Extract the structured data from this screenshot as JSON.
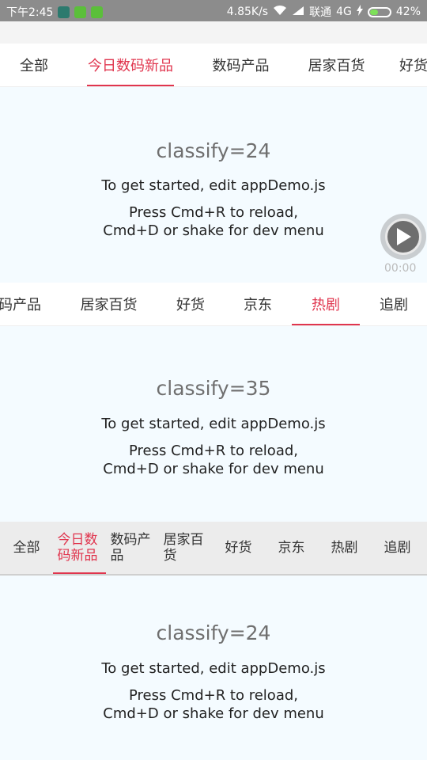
{
  "status_bar": {
    "time": "下午2:45",
    "speed": "4.85K/s",
    "carrier": "联通",
    "network": "4G",
    "battery": "42%",
    "battery_level": 0.42,
    "icons": [
      "notification-app-icon",
      "notification-lock-icon",
      "notification-android-icon",
      "wifi-icon",
      "signal-icon",
      "charging-icon",
      "battery-icon"
    ]
  },
  "tabs_top": {
    "items": [
      "全部",
      "今日数码新品",
      "数码产品",
      "居家百货",
      "好货"
    ],
    "active_index": 1
  },
  "panel1": {
    "title": "classify=24",
    "line1": "To get started, edit appDemo.js",
    "line2": "Press Cmd+R to reload,",
    "line3": "Cmd+D or shake for dev menu"
  },
  "video": {
    "time": "00:00"
  },
  "tabs_mid": {
    "items": [
      "码产品",
      "居家百货",
      "好货",
      "京东",
      "热剧",
      "追剧"
    ],
    "active_index": 4
  },
  "panel2": {
    "title": "classify=35",
    "line1": "To get started, edit appDemo.js",
    "line2": "Press Cmd+R to reload,",
    "line3": "Cmd+D or shake for dev menu"
  },
  "tabs_bottom": {
    "items": [
      "全部",
      "今日数码新品",
      "数码产品",
      "居家百货",
      "好货",
      "京东",
      "热剧",
      "追剧"
    ],
    "active_index": 1
  },
  "panel3": {
    "title": "classify=24",
    "line1": "To get started, edit appDemo.js",
    "line2": "Press Cmd+R to reload,",
    "line3": "Cmd+D or shake for dev menu"
  },
  "colors": {
    "accent": "#e0354e",
    "status_bar": "#8c8c8c",
    "panel_bg": "#f4fbff"
  }
}
